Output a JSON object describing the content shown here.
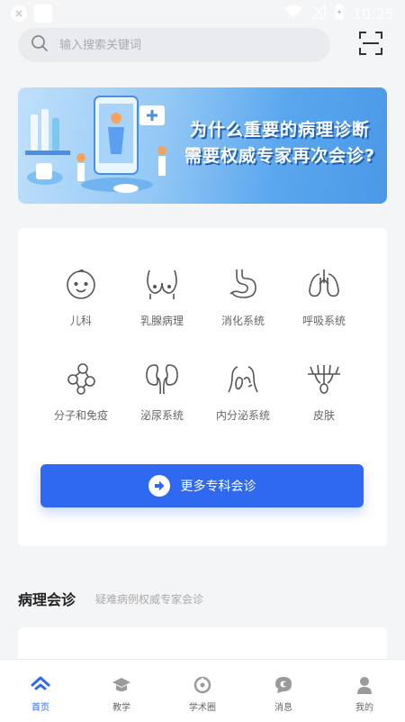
{
  "status_bar": {
    "time": "10:25",
    "wifi_icon": "wifi-icon",
    "signal_icon": "no-signal-icon",
    "battery_icon": "battery-icon"
  },
  "search": {
    "placeholder": "输入搜索关键词",
    "icon": "search-icon",
    "scan_icon": "scan-icon"
  },
  "banner": {
    "title_line1": "为什么重要的病理诊断",
    "title_line2": "需要权威专家再次会诊?"
  },
  "categories": [
    {
      "label": "儿科",
      "icon": "baby-face-icon"
    },
    {
      "label": "乳腺病理",
      "icon": "breast-icon"
    },
    {
      "label": "消化系统",
      "icon": "stomach-icon"
    },
    {
      "label": "呼吸系统",
      "icon": "lungs-icon"
    },
    {
      "label": "分子和免疫",
      "icon": "molecule-icon"
    },
    {
      "label": "泌尿系统",
      "icon": "kidneys-icon"
    },
    {
      "label": "内分泌系统",
      "icon": "thyroid-icon"
    },
    {
      "label": "皮肤",
      "icon": "skin-hair-icon"
    }
  ],
  "more_button": {
    "label": "更多专科会诊",
    "icon": "arrow-right-circle-icon"
  },
  "section": {
    "title": "病理会诊",
    "subtitle": "疑难病例权威专家会诊"
  },
  "bottom_nav": [
    {
      "label": "首页",
      "icon": "home-icon",
      "active": true
    },
    {
      "label": "教学",
      "icon": "graduation-cap-icon",
      "active": false
    },
    {
      "label": "学术圈",
      "icon": "circle-icon",
      "active": false
    },
    {
      "label": "消息",
      "icon": "message-icon",
      "active": false
    },
    {
      "label": "我的",
      "icon": "user-icon",
      "active": false
    }
  ],
  "colors": {
    "accent": "#2f69ef",
    "background": "#f4f5f7"
  }
}
